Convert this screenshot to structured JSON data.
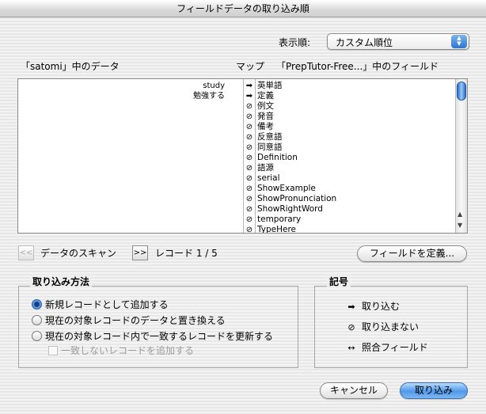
{
  "window": {
    "title": "フィールドデータの取り込み順"
  },
  "display_order": {
    "label": "表示順:",
    "value": "カスタム順位"
  },
  "headers": {
    "source": "「satomi」中のデータ",
    "map": "マップ",
    "target": "「PrepTutor-Free...」中のフィールド"
  },
  "mapping_rows": [
    {
      "source": "study",
      "symbol": "➡",
      "target": "英単語"
    },
    {
      "source": "勉強する",
      "symbol": "➡",
      "target": "定義"
    },
    {
      "source": "",
      "symbol": "⊘",
      "target": "例文"
    },
    {
      "source": "",
      "symbol": "⊘",
      "target": "発音"
    },
    {
      "source": "",
      "symbol": "⊘",
      "target": "備考"
    },
    {
      "source": "",
      "symbol": "⊘",
      "target": "反意語"
    },
    {
      "source": "",
      "symbol": "⊘",
      "target": "同意語"
    },
    {
      "source": "",
      "symbol": "⊘",
      "target": "Definition"
    },
    {
      "source": "",
      "symbol": "⊘",
      "target": "語源"
    },
    {
      "source": "",
      "symbol": "⊘",
      "target": "serial"
    },
    {
      "source": "",
      "symbol": "⊘",
      "target": "ShowExample"
    },
    {
      "source": "",
      "symbol": "⊘",
      "target": "ShowPronunciation"
    },
    {
      "source": "",
      "symbol": "⊘",
      "target": "ShowRightWord"
    },
    {
      "source": "",
      "symbol": "⊘",
      "target": "temporary"
    },
    {
      "source": "",
      "symbol": "⊘",
      "target": "TypeHere"
    }
  ],
  "scan": {
    "prev_label": "<<",
    "label": "データのスキャン",
    "next_label": ">>",
    "record_status": "レコード 1 / 5"
  },
  "define_fields_button": "フィールドを定義...",
  "import_method": {
    "title": "取り込み方法",
    "options": [
      {
        "label": "新規レコードとして追加する",
        "selected": true
      },
      {
        "label": "現在の対象レコードのデータと置き換える",
        "selected": false
      },
      {
        "label": "現在の対象レコード内で一致するレコードを更新する",
        "selected": false
      }
    ],
    "checkbox_label": "一致しないレコードを追加する"
  },
  "legend": {
    "title": "記号",
    "items": [
      {
        "icon": "arrow-right-icon",
        "symbol": "➡",
        "label": "取り込む"
      },
      {
        "icon": "no-import-icon",
        "symbol": "⊘",
        "label": "取り込まない"
      },
      {
        "icon": "match-field-icon",
        "symbol": "↔",
        "label": "照合フィールド"
      }
    ]
  },
  "buttons": {
    "cancel": "キャンセル",
    "import": "取り込み"
  }
}
